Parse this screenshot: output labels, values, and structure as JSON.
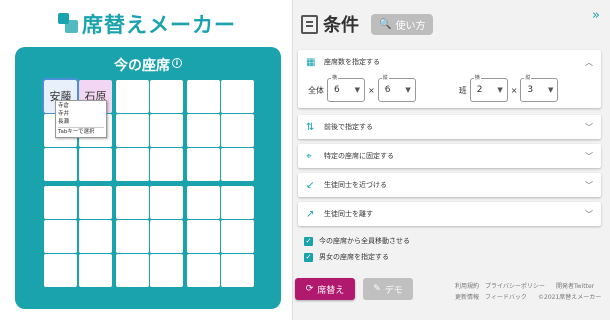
{
  "brand": {
    "title": "席替えメーカー"
  },
  "board": {
    "title": "今の座席",
    "seat_labels": [
      "安藤",
      "石原"
    ],
    "menu": {
      "items": [
        "寺倉",
        "寺井",
        "長瀬"
      ],
      "hint": "Tabキーで選択"
    }
  },
  "conditions": {
    "title": "条件",
    "howto_label": "使い方",
    "seat_count": {
      "label": "座席数を指定する",
      "overall_label": "全体",
      "rows_label": "横",
      "cols_label": "縦",
      "overall_rows": "6",
      "overall_cols": "6",
      "times": "×",
      "group_label": "班",
      "group_rows": "2",
      "group_cols": "3"
    },
    "options": [
      {
        "label": "前後で指定する"
      },
      {
        "label": "特定の座席に固定する"
      },
      {
        "label": "生徒同士を近づける"
      },
      {
        "label": "生徒同士を離す"
      }
    ],
    "checkboxes": [
      {
        "label": "今の座席から全員移動させる",
        "checked": true
      },
      {
        "label": "男女の座席を指定する",
        "checked": true
      }
    ]
  },
  "actions": {
    "shuffle_label": "席替え",
    "demo_label": "デモ"
  },
  "footer": {
    "links": [
      "利用規約",
      "プライバシーポリシー",
      "開発者Twitter",
      "更新情報",
      "フィードバック"
    ],
    "copyright": "©2021席替えメーカー"
  },
  "colors": {
    "accent": "#1aa3ad",
    "primary_button": "#b0196d",
    "panel": "#f2f2f2"
  }
}
